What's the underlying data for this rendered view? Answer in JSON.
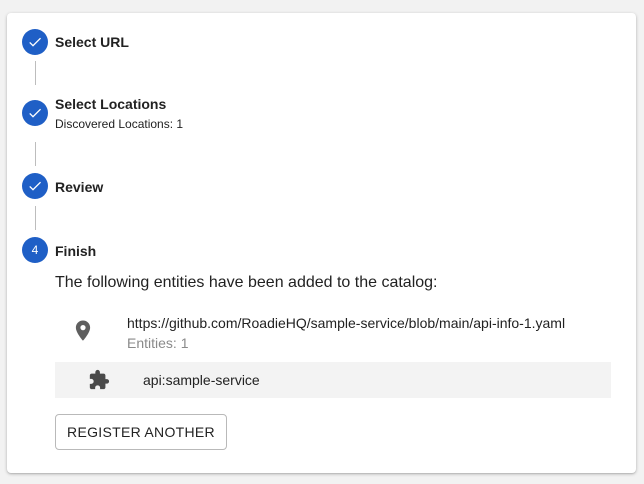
{
  "colors": {
    "step_active": "#1f5fc6",
    "connector": "#bdbdbd",
    "muted_text": "#8a8a8a",
    "row_bg": "#f3f3f3"
  },
  "steps": [
    {
      "title": "Select URL",
      "state": "completed",
      "icon": "check-icon"
    },
    {
      "title": "Select Locations",
      "subtitle": "Discovered Locations: 1",
      "state": "completed",
      "icon": "check-icon"
    },
    {
      "title": "Review",
      "state": "completed",
      "icon": "check-icon"
    },
    {
      "title": "Finish",
      "number": "4",
      "state": "active"
    }
  ],
  "finish": {
    "message": "The following entities have been added to the catalog:",
    "location": {
      "icon": "location-pin-icon",
      "url": "https://github.com/RoadieHQ/sample-service/blob/main/api-info-1.yaml",
      "entities": "Entities: 1"
    },
    "entity": {
      "icon": "puzzle-piece-icon",
      "name": "api:sample-service"
    },
    "register_label": "REGISTER ANOTHER"
  }
}
